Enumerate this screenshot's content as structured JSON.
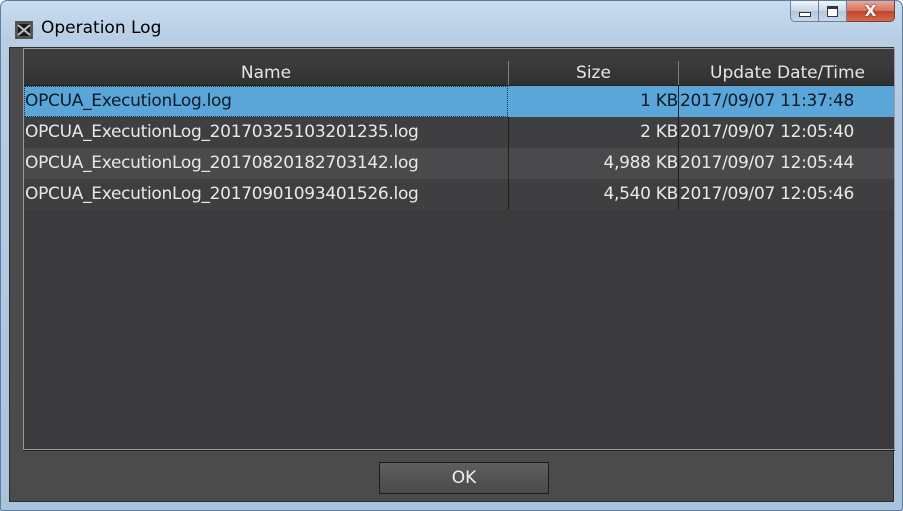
{
  "window": {
    "title": "Operation Log",
    "app_icon": "opcua-app-icon",
    "buttons": {
      "minimize_icon": "minimize-icon",
      "maximize_icon": "maximize-icon",
      "close_glyph": "X"
    }
  },
  "table": {
    "columns": [
      "Name",
      "Size",
      "Update Date/Time"
    ],
    "rows": [
      {
        "name": "OPCUA_ExecutionLog.log",
        "size": "1 KB",
        "date": "2017/09/07 11:37:48",
        "selected": true
      },
      {
        "name": "OPCUA_ExecutionLog_20170325103201235.log",
        "size": "2 KB",
        "date": "2017/09/07 12:05:40"
      },
      {
        "name": "OPCUA_ExecutionLog_20170820182703142.log",
        "size": "4,988 KB",
        "date": "2017/09/07 12:05:44"
      },
      {
        "name": "OPCUA_ExecutionLog_20170901093401526.log",
        "size": "4,540 KB",
        "date": "2017/09/07 12:05:46"
      }
    ]
  },
  "footer": {
    "ok_label": "OK"
  },
  "colors": {
    "selection": "#5aa6d8",
    "grid_background": "#3b3b3d",
    "text": "#e8e8e8"
  }
}
